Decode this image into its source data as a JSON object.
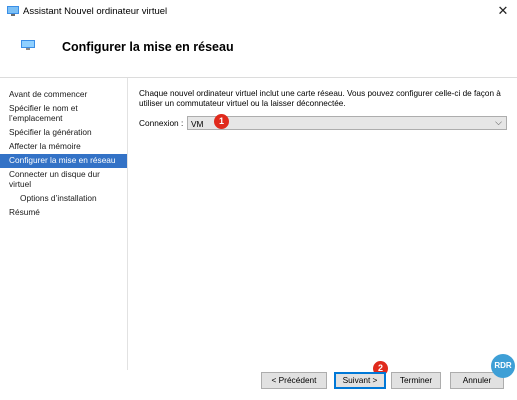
{
  "window": {
    "title": "Assistant Nouvel ordinateur virtuel",
    "close_glyph": "✕"
  },
  "header": {
    "title": "Configurer la mise en réseau",
    "icon": "network-monitor-icon"
  },
  "sidebar": {
    "items": [
      {
        "label": "Avant de commencer",
        "active": false
      },
      {
        "label": "Spécifier le nom et l’emplacement",
        "active": false
      },
      {
        "label": "Spécifier la génération",
        "active": false
      },
      {
        "label": "Affecter la mémoire",
        "active": false
      },
      {
        "label": "Configurer la mise en réseau",
        "active": true
      },
      {
        "label": "Connecter un disque dur virtuel",
        "active": false
      },
      {
        "label": "Options d’installation",
        "active": false
      },
      {
        "label": "Résumé",
        "active": false
      }
    ]
  },
  "main": {
    "description": "Chaque nouvel ordinateur virtuel inclut une carte réseau. Vous pouvez configurer celle-ci de façon à utiliser un commutateur virtuel ou la laisser déconnectée.",
    "connection_label": "Connexion :",
    "connection_value": "VM"
  },
  "annotations": {
    "badge1": "1",
    "badge2": "2"
  },
  "buttons": {
    "previous": "< Précédent",
    "next": "Suivant >",
    "finish": "Terminer",
    "cancel": "Annuler"
  },
  "watermark": "RDR",
  "colors": {
    "accent": "#3372c6",
    "badge": "#e02a1c",
    "default_button_border": "#0078d7"
  }
}
